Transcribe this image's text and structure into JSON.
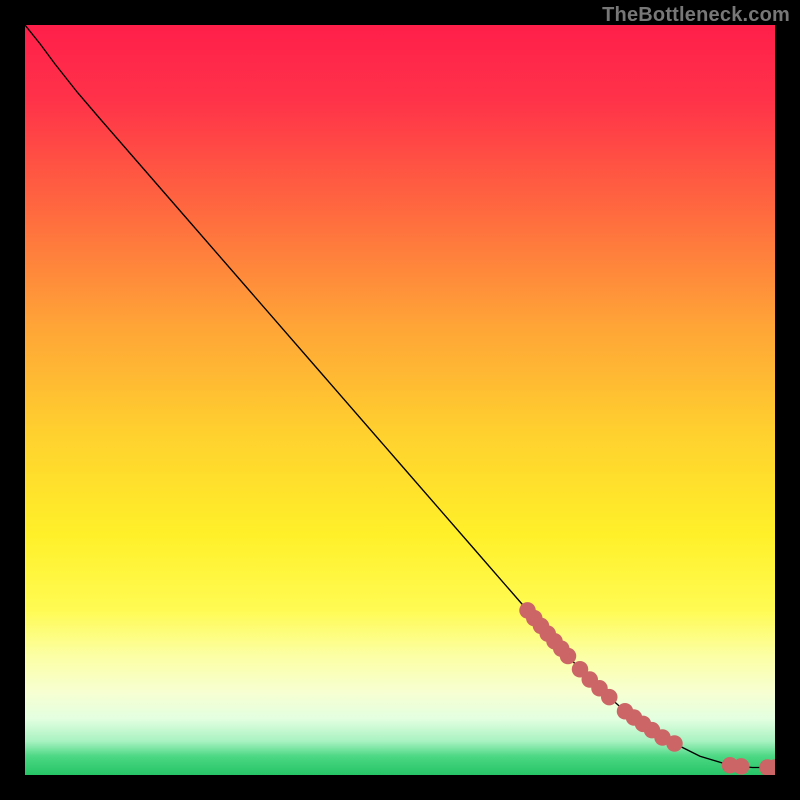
{
  "watermark": "TheBottleneck.com",
  "colors": {
    "curve": "#000000",
    "dots": "#cc6666",
    "green_band_top": "#3fd97a",
    "green_band_mid": "#2bc46c",
    "background_black": "#000000"
  },
  "chart_data": {
    "type": "line",
    "title": "",
    "xlabel": "",
    "ylabel": "",
    "xlim": [
      0,
      100
    ],
    "ylim": [
      0,
      100
    ],
    "gradient_stops": [
      {
        "pos": 0.0,
        "color": "#ff1f4a"
      },
      {
        "pos": 0.1,
        "color": "#ff3249"
      },
      {
        "pos": 0.25,
        "color": "#ff6a3f"
      },
      {
        "pos": 0.4,
        "color": "#ffa437"
      },
      {
        "pos": 0.55,
        "color": "#ffd22e"
      },
      {
        "pos": 0.68,
        "color": "#fff029"
      },
      {
        "pos": 0.78,
        "color": "#fffb53"
      },
      {
        "pos": 0.84,
        "color": "#fcffa3"
      },
      {
        "pos": 0.89,
        "color": "#f7ffd2"
      },
      {
        "pos": 0.925,
        "color": "#e3ffe0"
      },
      {
        "pos": 0.955,
        "color": "#a8f2c1"
      },
      {
        "pos": 0.975,
        "color": "#4cd884"
      },
      {
        "pos": 1.0,
        "color": "#26c466"
      }
    ],
    "curve": [
      {
        "x": 0.0,
        "y": 100.0
      },
      {
        "x": 2.0,
        "y": 97.5
      },
      {
        "x": 4.0,
        "y": 94.8
      },
      {
        "x": 7.0,
        "y": 91.0
      },
      {
        "x": 10.0,
        "y": 87.5
      },
      {
        "x": 20.0,
        "y": 76.0
      },
      {
        "x": 30.0,
        "y": 64.5
      },
      {
        "x": 40.0,
        "y": 53.0
      },
      {
        "x": 50.0,
        "y": 41.5
      },
      {
        "x": 60.0,
        "y": 30.0
      },
      {
        "x": 70.0,
        "y": 18.5
      },
      {
        "x": 75.0,
        "y": 13.0
      },
      {
        "x": 80.0,
        "y": 8.5
      },
      {
        "x": 85.0,
        "y": 5.0
      },
      {
        "x": 90.0,
        "y": 2.5
      },
      {
        "x": 94.0,
        "y": 1.3
      },
      {
        "x": 97.0,
        "y": 1.0
      },
      {
        "x": 100.0,
        "y": 1.0
      }
    ],
    "dot_segments": [
      {
        "x0": 67.0,
        "x1": 73.0,
        "spacing": 0.9,
        "r": 1.1
      },
      {
        "x0": 74.0,
        "x1": 79.0,
        "spacing": 1.3,
        "r": 1.1
      },
      {
        "x0": 80.0,
        "x1": 84.0,
        "spacing": 1.2,
        "r": 1.1
      },
      {
        "x0": 85.0,
        "x1": 88.0,
        "spacing": 1.6,
        "r": 1.1
      }
    ],
    "dot_extras": [
      {
        "x": 94.0,
        "r": 1.1
      },
      {
        "x": 95.5,
        "r": 1.1
      },
      {
        "x": 99.0,
        "r": 1.1
      },
      {
        "x": 100.0,
        "r": 1.1
      }
    ]
  }
}
